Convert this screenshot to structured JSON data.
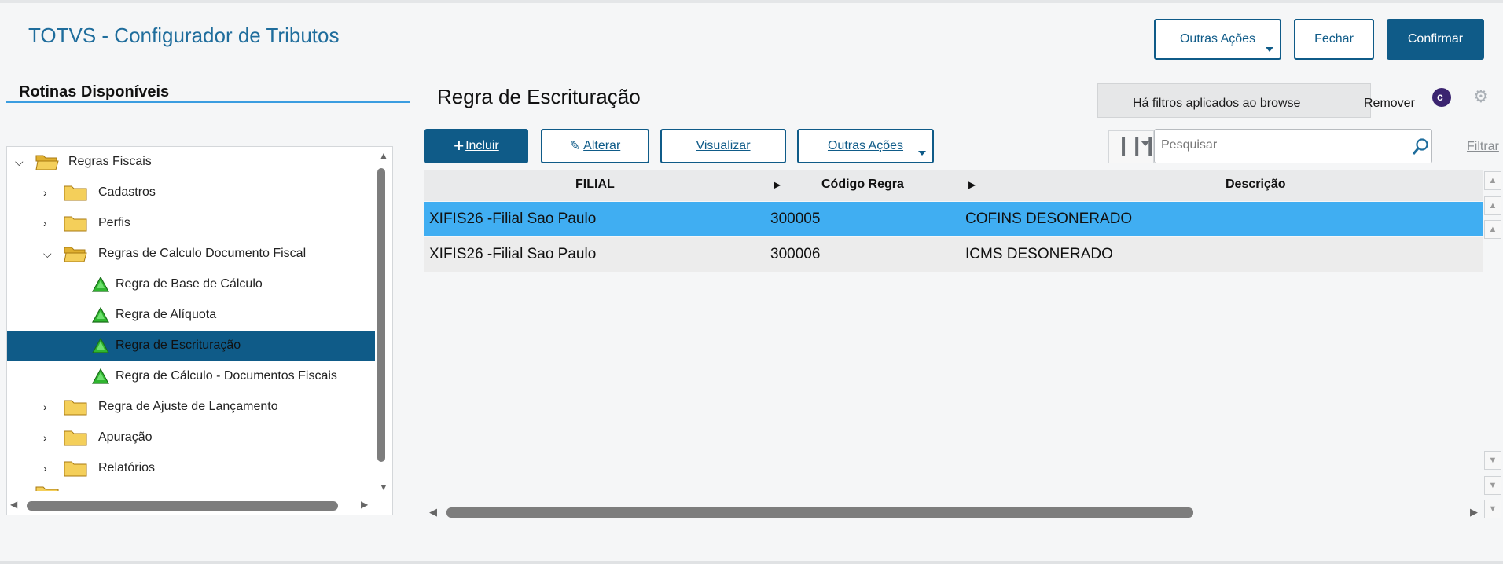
{
  "app_title": "TOTVS - Configurador de Tributos",
  "header": {
    "outras_acoes": "Outras Ações",
    "fechar": "Fechar",
    "confirmar": "Confirmar"
  },
  "sidebar": {
    "title": "Rotinas Disponíveis",
    "tree": [
      {
        "label": "Regras Fiscais",
        "level": 0,
        "expanded": true,
        "icon": "folder-open-icon"
      },
      {
        "label": "Cadastros",
        "level": 1,
        "expanded": false,
        "icon": "folder-icon"
      },
      {
        "label": "Perfis",
        "level": 1,
        "expanded": false,
        "icon": "folder-icon"
      },
      {
        "label": "Regras de Calculo Documento Fiscal",
        "level": 1,
        "expanded": true,
        "icon": "folder-open-icon"
      },
      {
        "label": "Regra de Base de Cálculo",
        "level": 2,
        "icon": "green-triangle-icon"
      },
      {
        "label": "Regra de Alíquota",
        "level": 2,
        "icon": "green-triangle-icon"
      },
      {
        "label": "Regra de Escrituração",
        "level": 2,
        "icon": "green-triangle-icon",
        "selected": true
      },
      {
        "label": "Regra de Cálculo - Documentos Fiscais",
        "level": 2,
        "icon": "green-triangle-icon"
      },
      {
        "label": "Regra de Ajuste de Lançamento",
        "level": 1,
        "expanded": false,
        "icon": "folder-icon"
      },
      {
        "label": "Apuração",
        "level": 1,
        "expanded": false,
        "icon": "folder-icon"
      },
      {
        "label": "Relatórios",
        "level": 1,
        "expanded": false,
        "icon": "folder-icon"
      }
    ]
  },
  "main": {
    "title": "Regra de Escrituração",
    "filter_notice": "Há filtros aplicados ao browse",
    "remover": "Remover",
    "toolbar": {
      "incluir": "Incluir",
      "alterar": "Alterar",
      "visualizar": "Visualizar",
      "outras_acoes": "Outras Ações"
    },
    "search_placeholder": "Pesquisar",
    "filtrar": "Filtrar",
    "columns": [
      "FILIAL",
      "Código Regra",
      "Descrição"
    ],
    "rows": [
      {
        "filial": "XIFIS26 -Filial Sao Paulo",
        "codigo": "300005",
        "descricao": "COFINS DESONERADO"
      },
      {
        "filial": "XIFIS26 -Filial Sao Paulo",
        "codigo": "300006",
        "descricao": "ICMS DESONERADO"
      }
    ]
  },
  "colors": {
    "brand_blue": "#0f5b88",
    "selection_blue": "#40aef2",
    "title_blue": "#1f6d9c"
  }
}
